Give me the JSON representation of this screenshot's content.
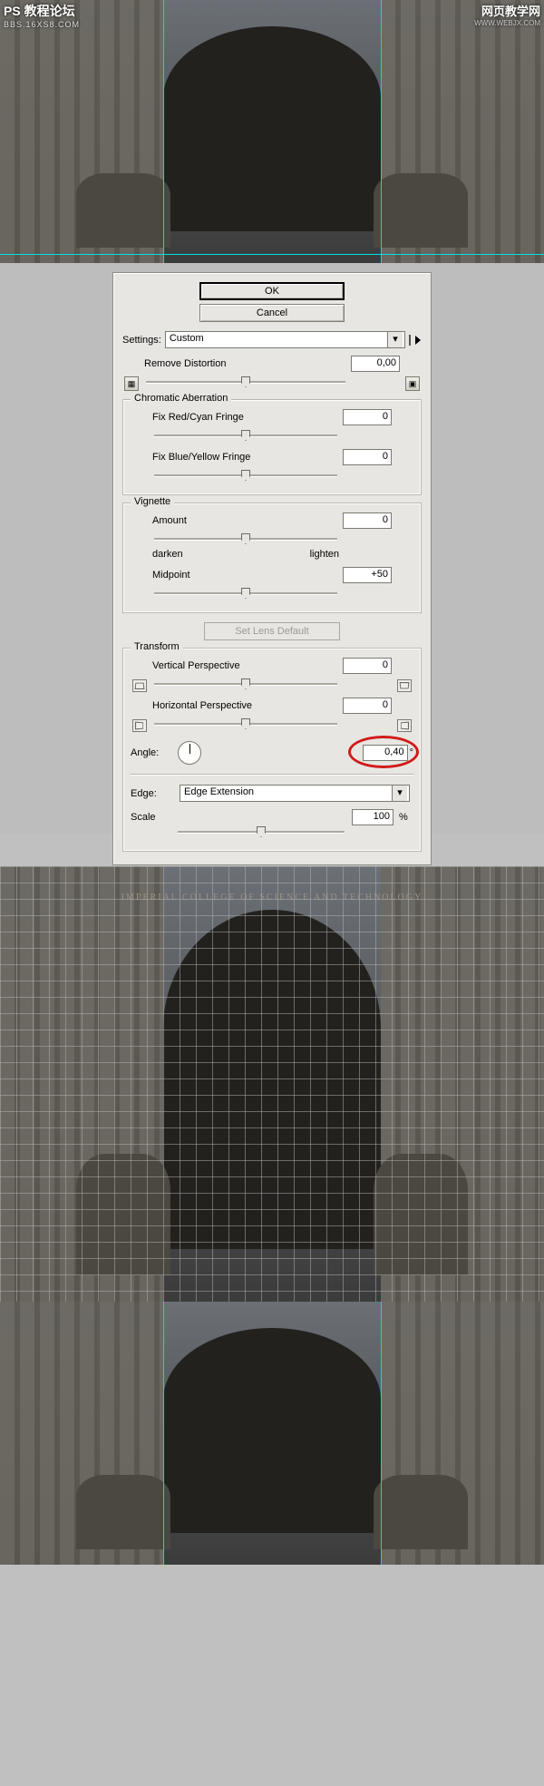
{
  "watermark": {
    "left_title": "PS 教程论坛",
    "left_sub": "BBS.16XS8.COM",
    "right_title": "网页教学网",
    "right_sub": "WWW.WEBJX.COM"
  },
  "inscription": "IMPERIAL COLLEGE OF SCIENCE AND TECHNOLOGY",
  "dialog": {
    "ok": "OK",
    "cancel": "Cancel",
    "settings_label": "Settings:",
    "settings_value": "Custom",
    "remove_distortion": {
      "label": "Remove Distortion",
      "value": "0,00"
    },
    "chromatic": {
      "title": "Chromatic Aberration",
      "red": {
        "label": "Fix Red/Cyan Fringe",
        "value": "0"
      },
      "blue": {
        "label": "Fix Blue/Yellow Fringe",
        "value": "0"
      }
    },
    "vignette": {
      "title": "Vignette",
      "amount": {
        "label": "Amount",
        "value": "0"
      },
      "darken": "darken",
      "lighten": "lighten",
      "midpoint": {
        "label": "Midpoint",
        "value": "+50"
      }
    },
    "set_lens_default": "Set Lens Default",
    "transform": {
      "title": "Transform",
      "vertical": {
        "label": "Vertical Perspective",
        "value": "0"
      },
      "horizontal": {
        "label": "Horizontal Perspective",
        "value": "0"
      },
      "angle": {
        "label": "Angle:",
        "value": "0,40",
        "unit": "°"
      }
    },
    "edge": {
      "label": "Edge:",
      "value": "Edge Extension"
    },
    "scale": {
      "label": "Scale",
      "value": "100",
      "unit": "%"
    }
  }
}
